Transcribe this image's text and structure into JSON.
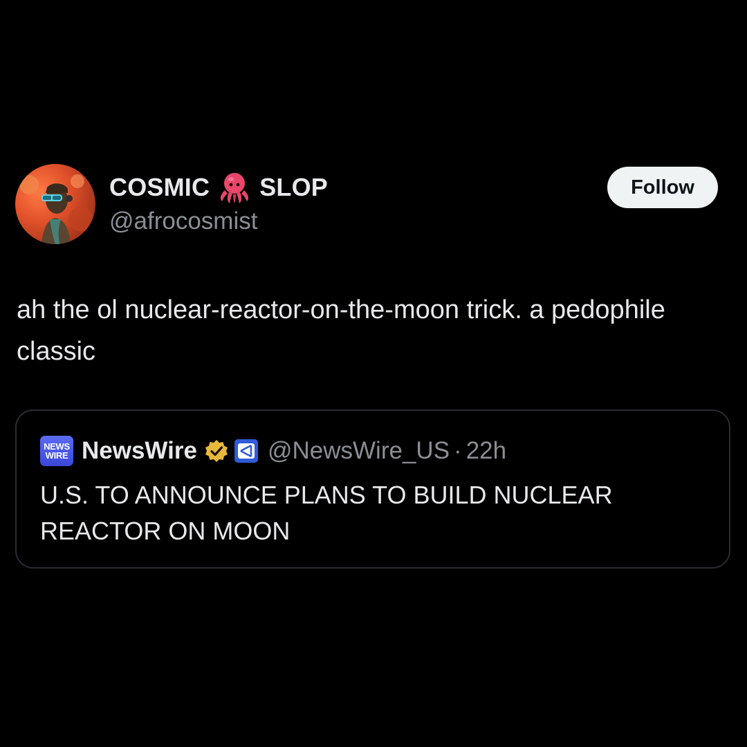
{
  "post": {
    "author": {
      "display_name_part1": "COSMIC",
      "display_name_emoji": "octopus-emoji",
      "display_name_part2": "SLOP",
      "handle": "@afrocosmist"
    },
    "follow_label": "Follow",
    "text": "ah the ol nuclear-reactor-on-the-moon trick. a pedophile classic"
  },
  "quote": {
    "logo_line1": "NEWS",
    "logo_line2": "WIRE",
    "name": "NewsWire",
    "verified_icon": "gold-verified-badge-icon",
    "affiliation_icon": "affiliate-badge-icon",
    "handle": "@NewsWire_US",
    "separator": "·",
    "time": "22h",
    "text": "U.S. TO ANNOUNCE PLANS TO BUILD NUCLEAR REACTOR ON MOON"
  },
  "colors": {
    "background": "#000000",
    "primary_text": "#e7e9ea",
    "secondary_text": "#8b8f94",
    "follow_button_bg": "#eff3f4",
    "card_border": "#2a2d31",
    "verified_gold": "#e8b83a",
    "brand_blue": "#3c46d8"
  }
}
